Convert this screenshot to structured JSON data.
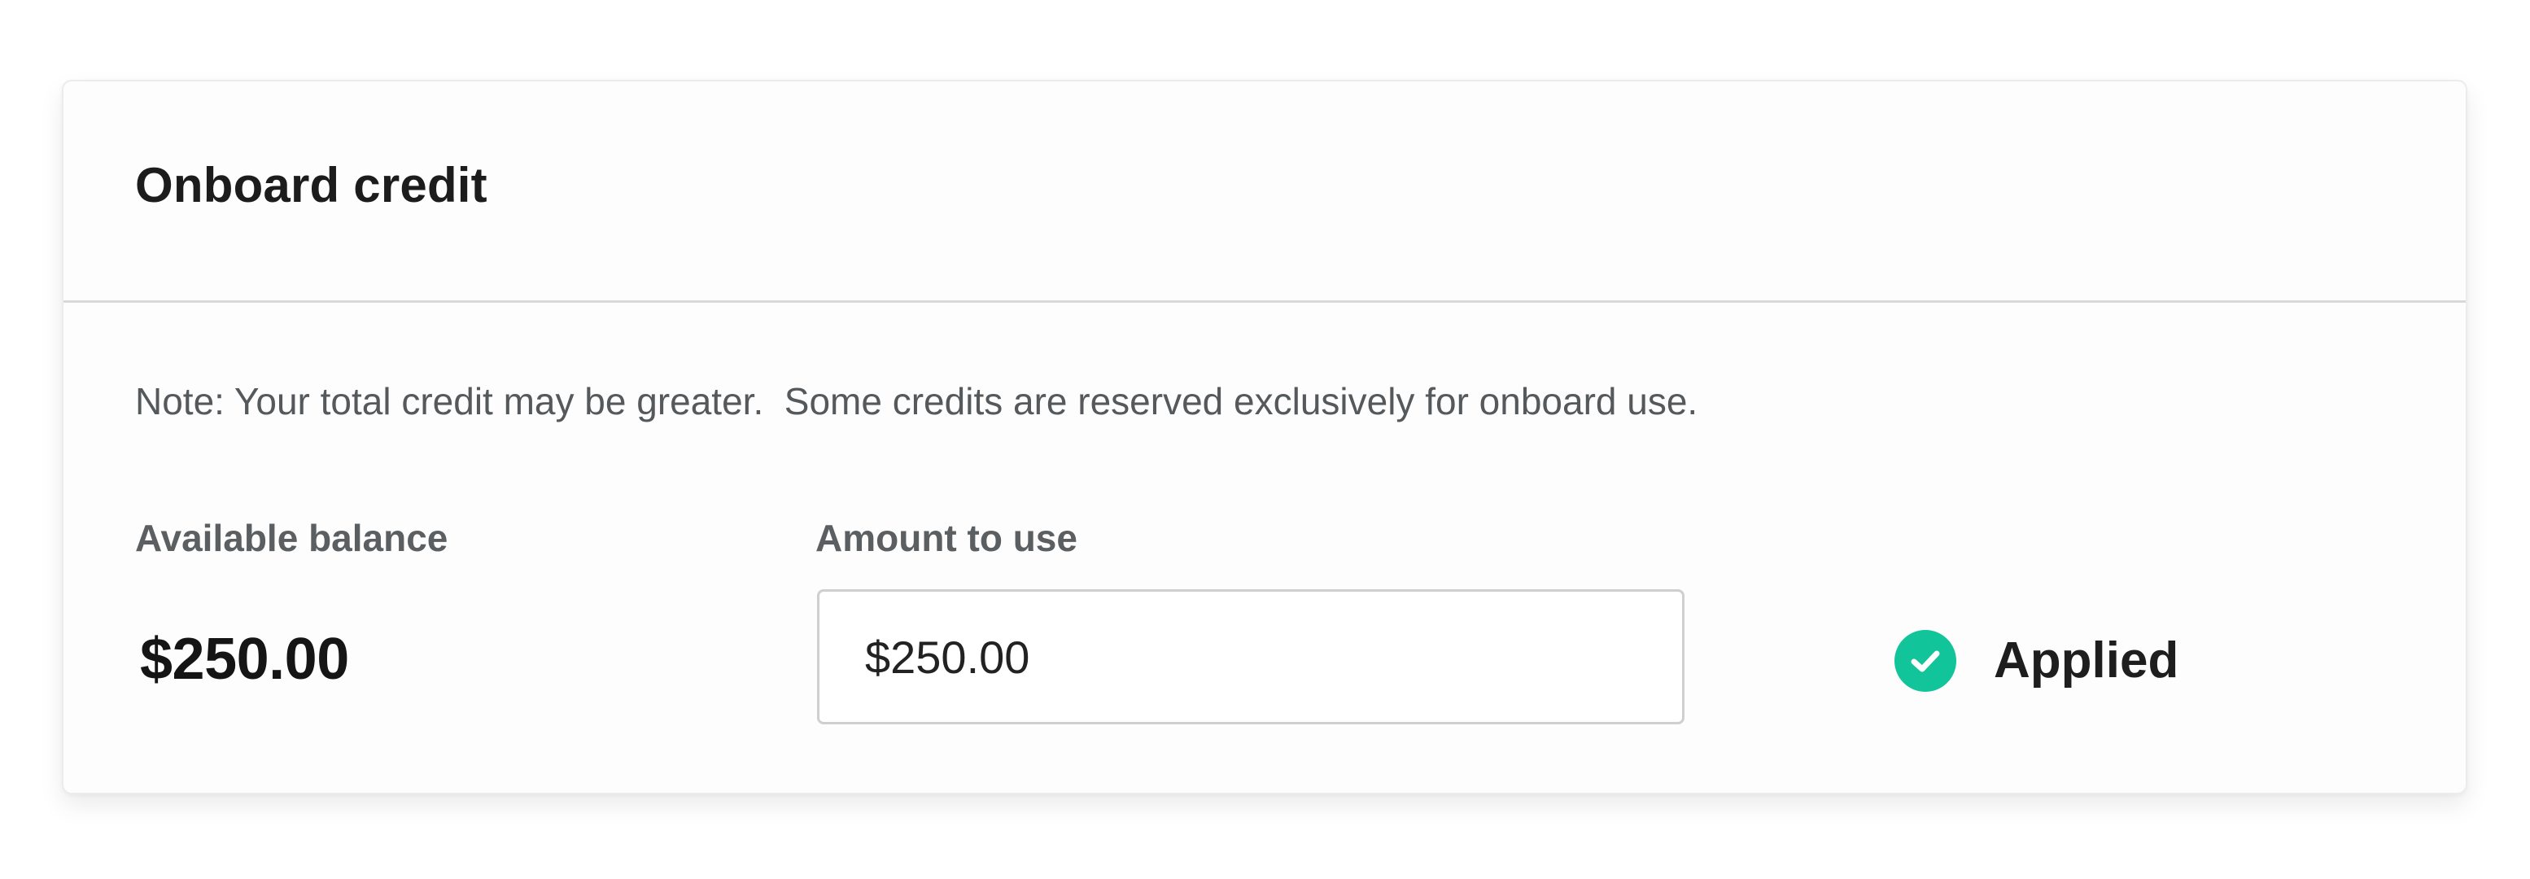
{
  "card": {
    "title": "Onboard credit",
    "note": "Note: Your total credit may be greater.  Some credits are reserved exclusively for onboard use."
  },
  "balance": {
    "label": "Available balance",
    "value": "$250.00"
  },
  "amount": {
    "label": "Amount to use",
    "value": "$250.00"
  },
  "status": {
    "label": "Applied",
    "icon": "check-circle-icon",
    "color": "#12c49a"
  }
}
